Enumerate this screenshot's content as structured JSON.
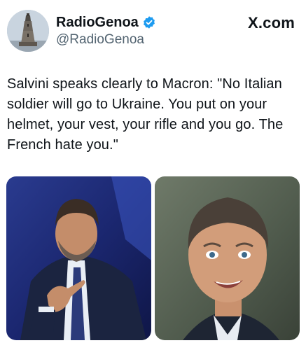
{
  "author": {
    "display_name": "RadioGenoa",
    "handle": "@RadioGenoa",
    "verified": true,
    "avatar_icon": "lantern-tower-avatar"
  },
  "source_label": "X.com",
  "tweet": {
    "text": "Salvini speaks clearly to Macron: \"No Italian soldier will go to Ukraine. You put on your helmet, your vest, your rifle and you go. The French hate you.\""
  },
  "media": {
    "left_photo": "man-in-suit-pointing-photo",
    "right_photo": "man-grimacing-photo"
  },
  "colors": {
    "verified_badge": "#1d9bf0",
    "handle": "#536471",
    "text": "#0f1419"
  }
}
